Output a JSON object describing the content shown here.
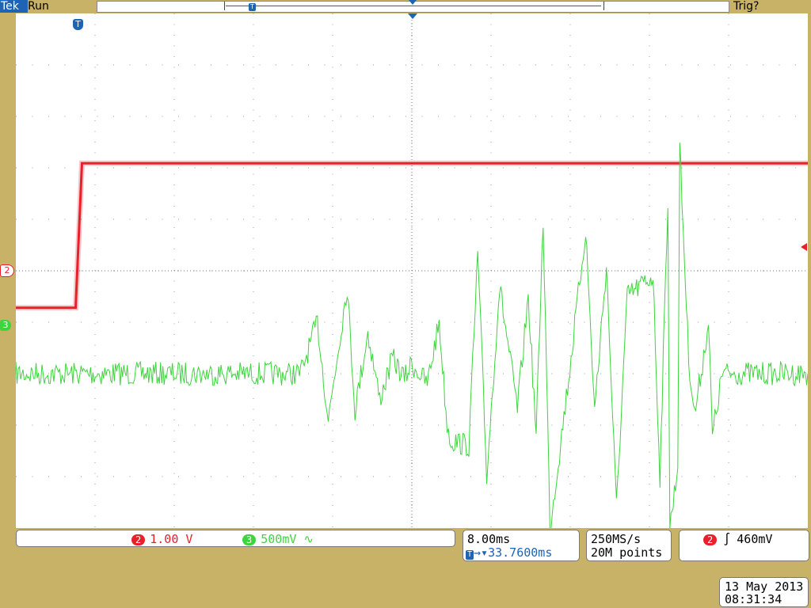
{
  "header": {
    "brand": "Tek",
    "status": "Run",
    "trigger_status": "Trig?"
  },
  "markers": {
    "trigger_marker": "T",
    "ch2_marker": "2",
    "ch3_marker": "3"
  },
  "bottom": {
    "ch2_badge": "2",
    "ch2_scale": "1.00 V",
    "ch3_badge": "3",
    "ch3_scale": "500mV",
    "ch3_bw_glyph": "∿",
    "timebase": "8.00ms",
    "trigger_pos_icon": "T",
    "trigger_pos_arrow": "→▾",
    "trigger_position": "33.7600ms",
    "sample_rate": "250MS/s",
    "record_length": "20M points",
    "trig_source_badge": "2",
    "trig_slope_glyph": "∫",
    "trig_level": "460mV"
  },
  "date": "13 May 2013",
  "time": "08:31:34",
  "colors": {
    "ch2": "#e8202a",
    "ch3": "#3ed43e",
    "brand": "#1f64b4",
    "frame": "#c8b268"
  },
  "chart_data": {
    "type": "line",
    "title": "",
    "xlabel": "",
    "ylabel": "",
    "xlim": [
      -7.76,
      72.24
    ],
    "ylim": [
      -4,
      6
    ],
    "x_unit": "ms",
    "grid": true,
    "grid_divisions": {
      "x": 10,
      "y": 10
    },
    "series": [
      {
        "channel": "2",
        "color": "#e8202a",
        "x": [
          -7.76,
          -1.72,
          -1.08,
          72.24
        ],
        "y": [
          0.28,
          0.28,
          3.09,
          3.09
        ]
      },
      {
        "channel": "3",
        "color": "#3ed43e",
        "x": [
          -7.76,
          21.0,
          22.7,
          23.8,
          25.7,
          26.5,
          27.8,
          29.0,
          30.3,
          31.5,
          32.2,
          33.8,
          35.0,
          35.8,
          36.2,
          38.0,
          38.9,
          39.8,
          41.1,
          42.9,
          44.0,
          44.8,
          45.5,
          46.2,
          48.2,
          49.8,
          50.7,
          51.9,
          52.9,
          54.0,
          56.6,
          57.3,
          58.1,
          58.3,
          59.1,
          59.3,
          60.2,
          60.8,
          61.6,
          62.2,
          62.6,
          63.6,
          72.24
        ],
        "y": [
          -1.0,
          -1.0,
          0.0,
          -1.9,
          0.7,
          -1.7,
          -0.2,
          -1.5,
          -0.7,
          -1.1,
          -0.8,
          -1.2,
          0.0,
          -2.0,
          -2.3,
          -2.4,
          1.3,
          -3.0,
          0.7,
          -1.7,
          0.5,
          -2.2,
          2.0,
          -4.0,
          -0.9,
          1.8,
          -1.7,
          1.1,
          -3.6,
          0.5,
          0.9,
          -3.0,
          2.4,
          -4.0,
          -2.8,
          3.4,
          -0.7,
          -1.8,
          -0.8,
          0.0,
          -2.2,
          -1.0,
          -1.0
        ]
      }
    ]
  }
}
